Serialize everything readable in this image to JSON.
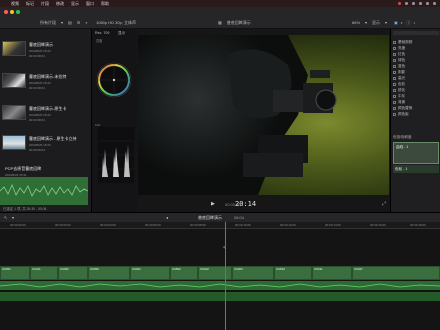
{
  "menubar": {
    "items": [
      "视频",
      "标记",
      "片段",
      "修改",
      "显示",
      "窗口",
      "帮助"
    ]
  },
  "toolbar": {
    "project_title": "普底回眸演示",
    "browser_filter": "所有片段",
    "viewer_format": "1080p HD 30p, 立体声",
    "zoom": "86%",
    "view_label": "显示"
  },
  "browser": {
    "clips": [
      {
        "title": "曹底回眸演示",
        "date": "2023/8/26 15:23",
        "dur": "00:00:08:04"
      },
      {
        "title": "曹底回眸演示-未拉特",
        "date": "2023/8/26 15:23",
        "dur": "00:00:08:04"
      },
      {
        "title": "曹底回眸演示-原生卡",
        "date": "2023/8/26 15:23",
        "dur": "00:00:08:04"
      },
      {
        "title": "曹底回眸演示 - 原生卡立持",
        "date": "2023/8/26 15:23",
        "dur": "00:00:08:04"
      },
      {
        "title": "PCP去原音曹底回眸",
        "date": "2023/8/26 15:31",
        "dur": "00:00:08:04"
      }
    ],
    "footer": "已选定 1 项, 共 26:30 , 00:04"
  },
  "scopes": {
    "title": "Rec. 709",
    "view_label": "显示",
    "zoom_label": "亮度"
  },
  "viewer": {
    "timecode": "20:14",
    "timecode_prefix": "00:00:00"
  },
  "inspector": {
    "items": [
      "基础视频",
      "亮度",
      "红色",
      "绿色",
      "蓝色",
      "阴影",
      "高光",
      "色彩",
      "锐化",
      "中灰",
      "背景",
      "颜色替换",
      "颜色板"
    ],
    "section_label": "色相/饱和度",
    "effects": [
      {
        "label": "曲线 - 1"
      },
      {
        "label": "色轮 - 1"
      }
    ]
  },
  "timeline": {
    "project_name": "普底回眸演示",
    "duration": "08:04",
    "ruler_marks": [
      "00:00:00:00",
      "00:00:02:00",
      "00:00:04:00",
      "00:00:06:00",
      "00:00:08:00",
      "00:00:10:00",
      "00:00:12:00",
      "00:00:14:00",
      "00:00:16:00",
      "00:00:18:00"
    ],
    "clip_labels": [
      "C0451",
      "C0411",
      "C0452",
      "C0452",
      "C0401",
      "C0502",
      "C0442",
      "C0403",
      "C0510",
      "C0411",
      "C0427"
    ]
  }
}
